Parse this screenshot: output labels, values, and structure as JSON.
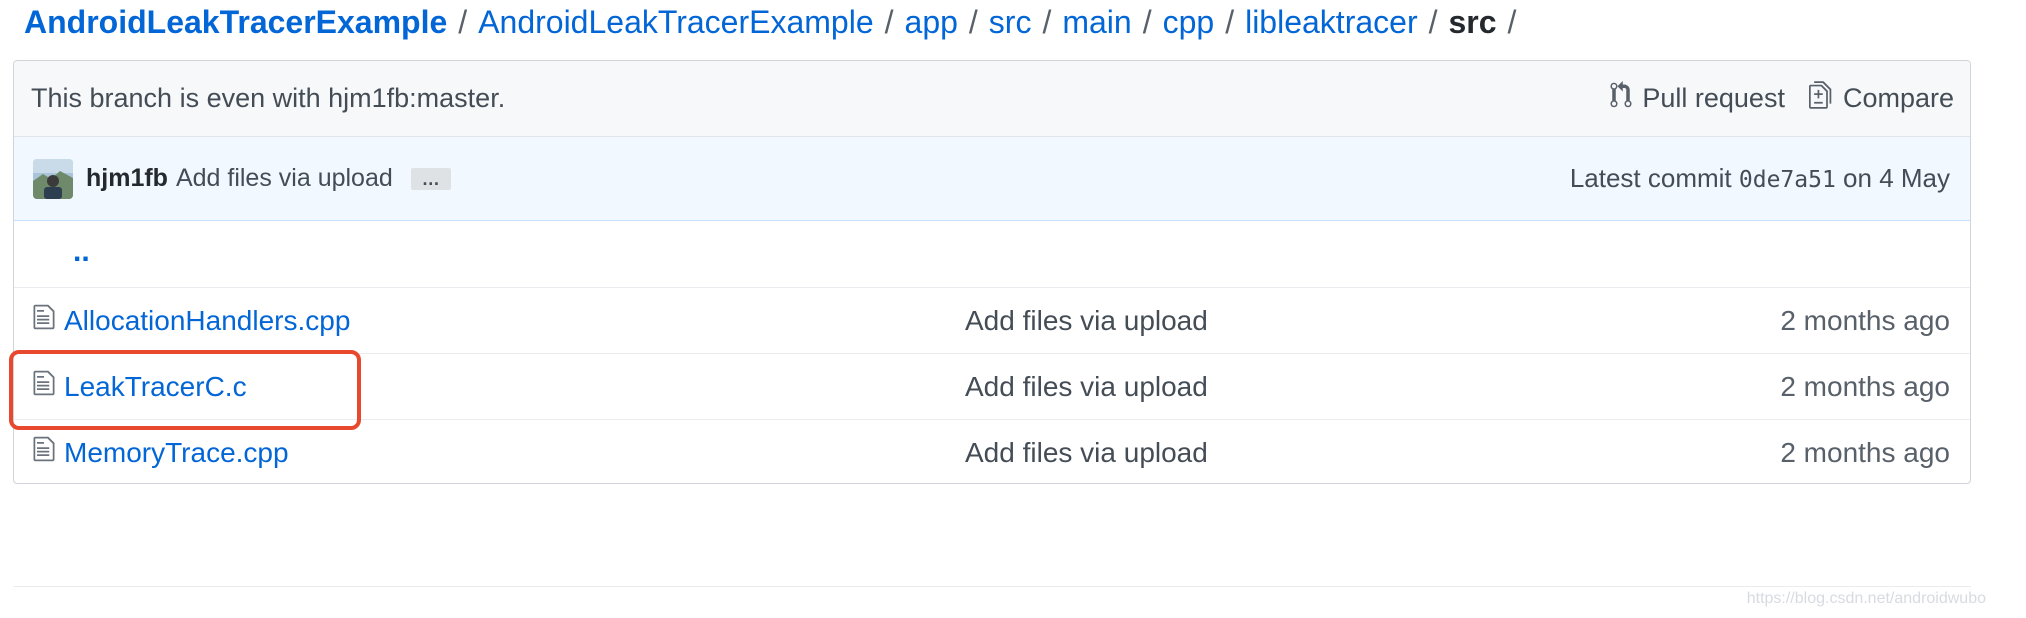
{
  "breadcrumb": {
    "items": [
      "AndroidLeakTracerExample",
      "AndroidLeakTracerExample",
      "app",
      "src",
      "main",
      "cpp",
      "libleaktracer"
    ],
    "current": "src",
    "separator": "/"
  },
  "branch_bar": {
    "status": "This branch is even with hjm1fb:master.",
    "pull_request_label": "Pull request",
    "compare_label": "Compare"
  },
  "commit": {
    "author": "hjm1fb",
    "message": "Add files via upload",
    "ellipsis": "…",
    "latest_prefix": "Latest commit",
    "sha": "0de7a51",
    "date": "on 4 May"
  },
  "parent_link": "..",
  "files": [
    {
      "name": "AllocationHandlers.cpp",
      "message": "Add files via upload",
      "age": "2 months ago"
    },
    {
      "name": "LeakTracerC.c",
      "message": "Add files via upload",
      "age": "2 months ago"
    },
    {
      "name": "MemoryTrace.cpp",
      "message": "Add files via upload",
      "age": "2 months ago"
    }
  ],
  "watermark": "https://blog.csdn.net/androidwubo",
  "colors": {
    "link": "#0366d6",
    "highlight": "#e8492e",
    "commit_bg": "#f1f8ff"
  }
}
